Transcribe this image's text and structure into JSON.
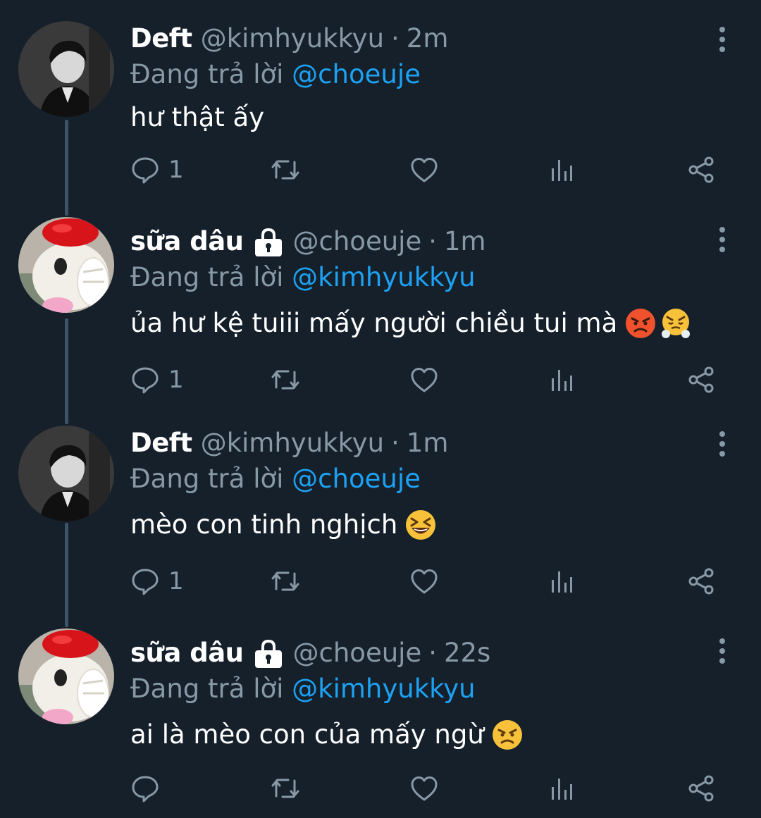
{
  "thread": {
    "tweets": [
      {
        "display_name": "Deft",
        "locked": false,
        "handle": "@kimhyukkyu",
        "separator": "·",
        "time": "2m",
        "reply_prefix": "Đang trả lời",
        "reply_to": "@choeuje",
        "text": "hư thật ấy",
        "emojis": [],
        "reply_count": "1",
        "avatar": "dark-portrait"
      },
      {
        "display_name": "sữa dâu",
        "locked": true,
        "handle": "@choeuje",
        "separator": "·",
        "time": "1m",
        "reply_prefix": "Đang trả lời",
        "reply_to": "@kimhyukkyu",
        "text": "ủa hư kệ tuiii mấy người chiều tui mà",
        "emojis": [
          "angry-red-face",
          "steam-from-nose-face"
        ],
        "reply_count": "1",
        "avatar": "hello-kitty-plush"
      },
      {
        "display_name": "Deft",
        "locked": false,
        "handle": "@kimhyukkyu",
        "separator": "·",
        "time": "1m",
        "reply_prefix": "Đang trả lời",
        "reply_to": "@choeuje",
        "text": "mèo con tinh nghịch",
        "emojis": [
          "laughing-squint-face"
        ],
        "reply_count": "1",
        "avatar": "dark-portrait"
      },
      {
        "display_name": "sữa dâu",
        "locked": true,
        "handle": "@choeuje",
        "separator": "·",
        "time": "22s",
        "reply_prefix": "Đang trả lời",
        "reply_to": "@kimhyukkyu",
        "text": "ai là mèo con của mấy ngừ",
        "emojis": [
          "angry-face"
        ],
        "reply_count": "",
        "avatar": "hello-kitty-plush"
      }
    ]
  },
  "icons": {
    "reply": "reply-icon",
    "retweet": "retweet-icon",
    "like": "heart-icon",
    "analytics": "analytics-icon",
    "share": "share-icon",
    "more": "more-vertical-icon",
    "lock": "lock-icon"
  },
  "colors": {
    "background": "#15202b",
    "secondary_text": "#8899a6",
    "mention": "#1da1f2",
    "thread_line": "#3d5466",
    "primary_text": "#ffffff"
  }
}
